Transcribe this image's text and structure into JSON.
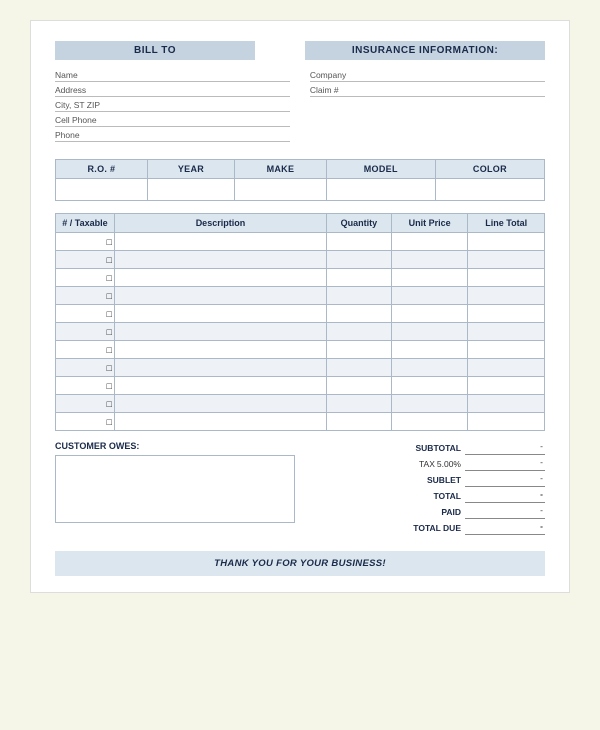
{
  "header": {
    "bill_to_label": "BILL TO",
    "insurance_label": "INSURANCE INFORMATION:"
  },
  "bill_to_fields": [
    {
      "label": "Name",
      "value": ""
    },
    {
      "label": "Address",
      "value": ""
    },
    {
      "label": "City, ST ZIP",
      "value": ""
    },
    {
      "label": "Cell Phone",
      "value": ""
    },
    {
      "label": "Phone",
      "value": ""
    }
  ],
  "insurance_fields": [
    {
      "label": "Company",
      "value": ""
    },
    {
      "label": "Claim #",
      "value": ""
    }
  ],
  "vehicle_table": {
    "columns": [
      "R.O. #",
      "YEAR",
      "MAKE",
      "MODEL",
      "COLOR"
    ]
  },
  "items_table": {
    "columns": [
      "# / Taxable",
      "Description",
      "Quantity",
      "Unit Price",
      "Line Total"
    ],
    "rows": 11
  },
  "totals": {
    "subtotal_label": "SUBTOTAL",
    "tax_label": "TAX",
    "tax_pct": "5.00%",
    "sublet_label": "SUBLET",
    "total_label": "TOTAL",
    "paid_label": "PAID",
    "total_due_label": "TOTAL DUE",
    "subtotal_value": "-",
    "tax_value": "-",
    "sublet_value": "-",
    "total_value": "-",
    "paid_value": "-",
    "total_due_value": "-"
  },
  "customer_owes": {
    "label": "CUSTOMER OWES:"
  },
  "footer": {
    "text": "THANK YOU FOR YOUR BUSINESS!"
  }
}
